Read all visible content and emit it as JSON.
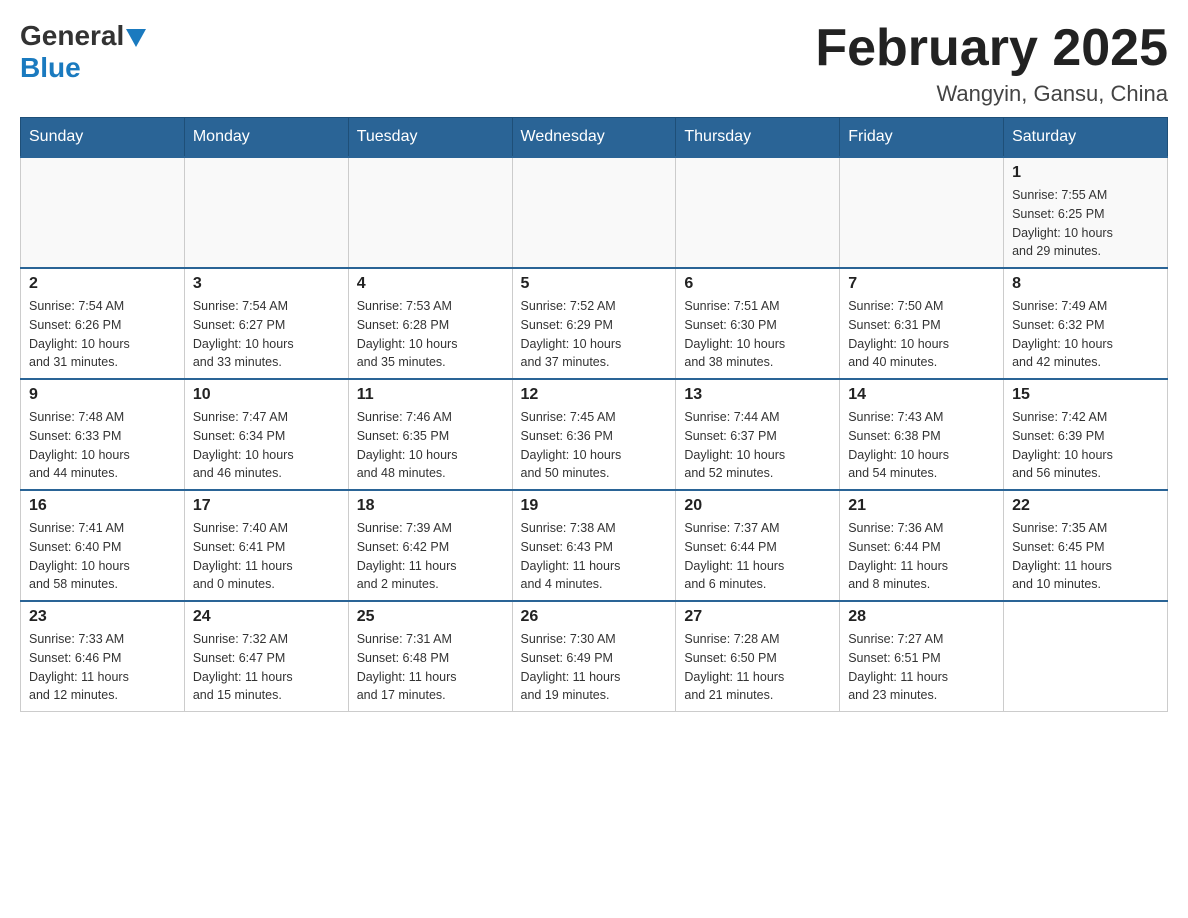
{
  "header": {
    "logo_general": "General",
    "logo_blue": "Blue",
    "month_year": "February 2025",
    "location": "Wangyin, Gansu, China"
  },
  "days_of_week": [
    "Sunday",
    "Monday",
    "Tuesday",
    "Wednesday",
    "Thursday",
    "Friday",
    "Saturday"
  ],
  "weeks": [
    [
      {
        "day": "",
        "info": ""
      },
      {
        "day": "",
        "info": ""
      },
      {
        "day": "",
        "info": ""
      },
      {
        "day": "",
        "info": ""
      },
      {
        "day": "",
        "info": ""
      },
      {
        "day": "",
        "info": ""
      },
      {
        "day": "1",
        "info": "Sunrise: 7:55 AM\nSunset: 6:25 PM\nDaylight: 10 hours\nand 29 minutes."
      }
    ],
    [
      {
        "day": "2",
        "info": "Sunrise: 7:54 AM\nSunset: 6:26 PM\nDaylight: 10 hours\nand 31 minutes."
      },
      {
        "day": "3",
        "info": "Sunrise: 7:54 AM\nSunset: 6:27 PM\nDaylight: 10 hours\nand 33 minutes."
      },
      {
        "day": "4",
        "info": "Sunrise: 7:53 AM\nSunset: 6:28 PM\nDaylight: 10 hours\nand 35 minutes."
      },
      {
        "day": "5",
        "info": "Sunrise: 7:52 AM\nSunset: 6:29 PM\nDaylight: 10 hours\nand 37 minutes."
      },
      {
        "day": "6",
        "info": "Sunrise: 7:51 AM\nSunset: 6:30 PM\nDaylight: 10 hours\nand 38 minutes."
      },
      {
        "day": "7",
        "info": "Sunrise: 7:50 AM\nSunset: 6:31 PM\nDaylight: 10 hours\nand 40 minutes."
      },
      {
        "day": "8",
        "info": "Sunrise: 7:49 AM\nSunset: 6:32 PM\nDaylight: 10 hours\nand 42 minutes."
      }
    ],
    [
      {
        "day": "9",
        "info": "Sunrise: 7:48 AM\nSunset: 6:33 PM\nDaylight: 10 hours\nand 44 minutes."
      },
      {
        "day": "10",
        "info": "Sunrise: 7:47 AM\nSunset: 6:34 PM\nDaylight: 10 hours\nand 46 minutes."
      },
      {
        "day": "11",
        "info": "Sunrise: 7:46 AM\nSunset: 6:35 PM\nDaylight: 10 hours\nand 48 minutes."
      },
      {
        "day": "12",
        "info": "Sunrise: 7:45 AM\nSunset: 6:36 PM\nDaylight: 10 hours\nand 50 minutes."
      },
      {
        "day": "13",
        "info": "Sunrise: 7:44 AM\nSunset: 6:37 PM\nDaylight: 10 hours\nand 52 minutes."
      },
      {
        "day": "14",
        "info": "Sunrise: 7:43 AM\nSunset: 6:38 PM\nDaylight: 10 hours\nand 54 minutes."
      },
      {
        "day": "15",
        "info": "Sunrise: 7:42 AM\nSunset: 6:39 PM\nDaylight: 10 hours\nand 56 minutes."
      }
    ],
    [
      {
        "day": "16",
        "info": "Sunrise: 7:41 AM\nSunset: 6:40 PM\nDaylight: 10 hours\nand 58 minutes."
      },
      {
        "day": "17",
        "info": "Sunrise: 7:40 AM\nSunset: 6:41 PM\nDaylight: 11 hours\nand 0 minutes."
      },
      {
        "day": "18",
        "info": "Sunrise: 7:39 AM\nSunset: 6:42 PM\nDaylight: 11 hours\nand 2 minutes."
      },
      {
        "day": "19",
        "info": "Sunrise: 7:38 AM\nSunset: 6:43 PM\nDaylight: 11 hours\nand 4 minutes."
      },
      {
        "day": "20",
        "info": "Sunrise: 7:37 AM\nSunset: 6:44 PM\nDaylight: 11 hours\nand 6 minutes."
      },
      {
        "day": "21",
        "info": "Sunrise: 7:36 AM\nSunset: 6:44 PM\nDaylight: 11 hours\nand 8 minutes."
      },
      {
        "day": "22",
        "info": "Sunrise: 7:35 AM\nSunset: 6:45 PM\nDaylight: 11 hours\nand 10 minutes."
      }
    ],
    [
      {
        "day": "23",
        "info": "Sunrise: 7:33 AM\nSunset: 6:46 PM\nDaylight: 11 hours\nand 12 minutes."
      },
      {
        "day": "24",
        "info": "Sunrise: 7:32 AM\nSunset: 6:47 PM\nDaylight: 11 hours\nand 15 minutes."
      },
      {
        "day": "25",
        "info": "Sunrise: 7:31 AM\nSunset: 6:48 PM\nDaylight: 11 hours\nand 17 minutes."
      },
      {
        "day": "26",
        "info": "Sunrise: 7:30 AM\nSunset: 6:49 PM\nDaylight: 11 hours\nand 19 minutes."
      },
      {
        "day": "27",
        "info": "Sunrise: 7:28 AM\nSunset: 6:50 PM\nDaylight: 11 hours\nand 21 minutes."
      },
      {
        "day": "28",
        "info": "Sunrise: 7:27 AM\nSunset: 6:51 PM\nDaylight: 11 hours\nand 23 minutes."
      },
      {
        "day": "",
        "info": ""
      }
    ]
  ]
}
